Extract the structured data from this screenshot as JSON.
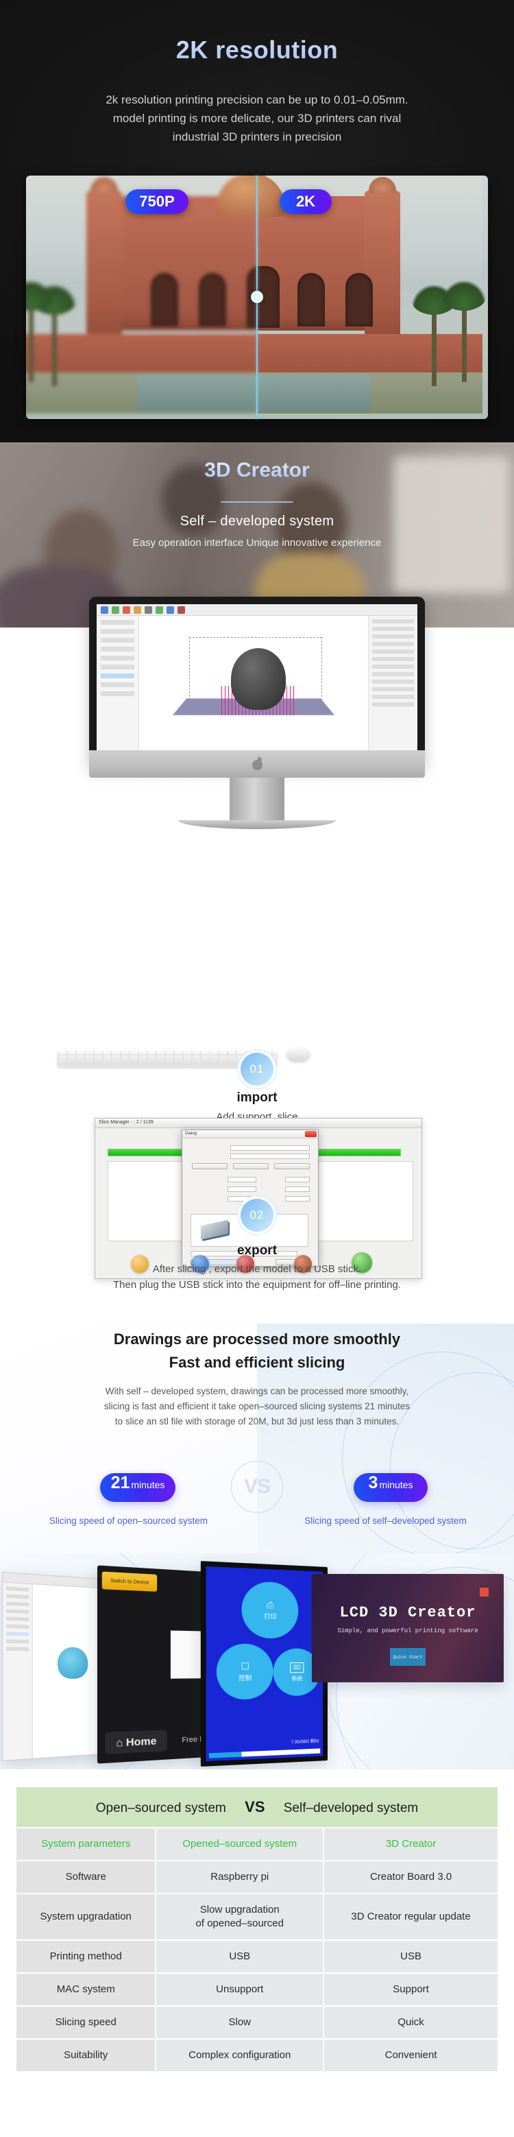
{
  "hero": {
    "title": "2K resolution",
    "description": "2k resolution printing precision can be up to 0.01–0.05mm.\nmodel printing is more delicate,  our 3D printers can rival\nindustrial 3D printers in precision",
    "badge_left": "750P",
    "badge_right": "2K",
    "accent_color": "#b9cdf6",
    "badge_gradient_from": "#1c5bf5",
    "badge_gradient_to": "#6d12f0"
  },
  "creator": {
    "title": "3D Creator",
    "subtitle": "Self – developed system",
    "tagline": "Easy operation interface  Unique innovative experience"
  },
  "steps": [
    {
      "number": "01",
      "title": "import",
      "description": "Add support, slice"
    },
    {
      "number": "02",
      "title": "export",
      "description": "After slicing , export the model to a USB stick.\nThen plug the USB stick into the equipment for off–line printing."
    }
  ],
  "slicer_window": {
    "window_title": "Slice Manager - : 2 / 1139",
    "dialog_title": "Dialog",
    "progress_value": "100%"
  },
  "speed": {
    "heading_line1": "Drawings are processed more smoothly",
    "heading_line2": "Fast and efficient slicing",
    "body": "With self – developed system, drawings can be processed more smoothly,\nslicing is fast and efficient it take open–sourced slicing systems 21 minutes\nto slice an stl file with storage of 20M, but 3d just less than 3 minutes.",
    "vs_label": "VS",
    "left_pill_value": "21",
    "left_pill_unit": "minutes",
    "right_pill_value": "3",
    "right_pill_unit": "minutes",
    "left_caption": "Slicing speed of open–sourced system",
    "right_caption": "Slicing speed of self–developed system",
    "caption_color": "#4a63d8"
  },
  "devices": {
    "black_tablet_tag": "Switch to Device",
    "black_tablet_home": "Home",
    "black_tablet_note": "Free Disk",
    "touch_buttons": [
      {
        "icon": "printer-icon",
        "glyph": "⎙",
        "label": "打印"
      },
      {
        "icon": "control-icon",
        "glyph": "☐",
        "label": "控制"
      },
      {
        "icon": "system-icon",
        "glyph": "3D",
        "label": "系统"
      }
    ],
    "status_text": "7.3G/58G  剩53",
    "software_card": {
      "title": "LCD 3D Creator",
      "subtitle": "Simple, and powerful printing software",
      "button": "Quick Start"
    }
  },
  "table": {
    "header_left": "Open–sourced system",
    "header_vs": "VS",
    "header_right": "Self–developed system",
    "header_bg": "#cfe5c0",
    "first_row_color": "#35c13f",
    "rows": [
      {
        "param": "System parameters",
        "open": "Opened–sourced system",
        "own": "3D Creator"
      },
      {
        "param": "Software",
        "open": "Raspberry pi",
        "own": "Creator Board 3.0"
      },
      {
        "param": "System upgradation",
        "open": "Slow upgradation\nof opened–sourced",
        "own": "3D Creator  regular update"
      },
      {
        "param": "Printing method",
        "open": "USB",
        "own": "USB"
      },
      {
        "param": "MAC system",
        "open": "Unsupport",
        "own": "Support"
      },
      {
        "param": "Slicing speed",
        "open": "Slow",
        "own": "Quick"
      },
      {
        "param": "Suitability",
        "open": "Complex configuration",
        "own": "Convenient"
      }
    ]
  }
}
